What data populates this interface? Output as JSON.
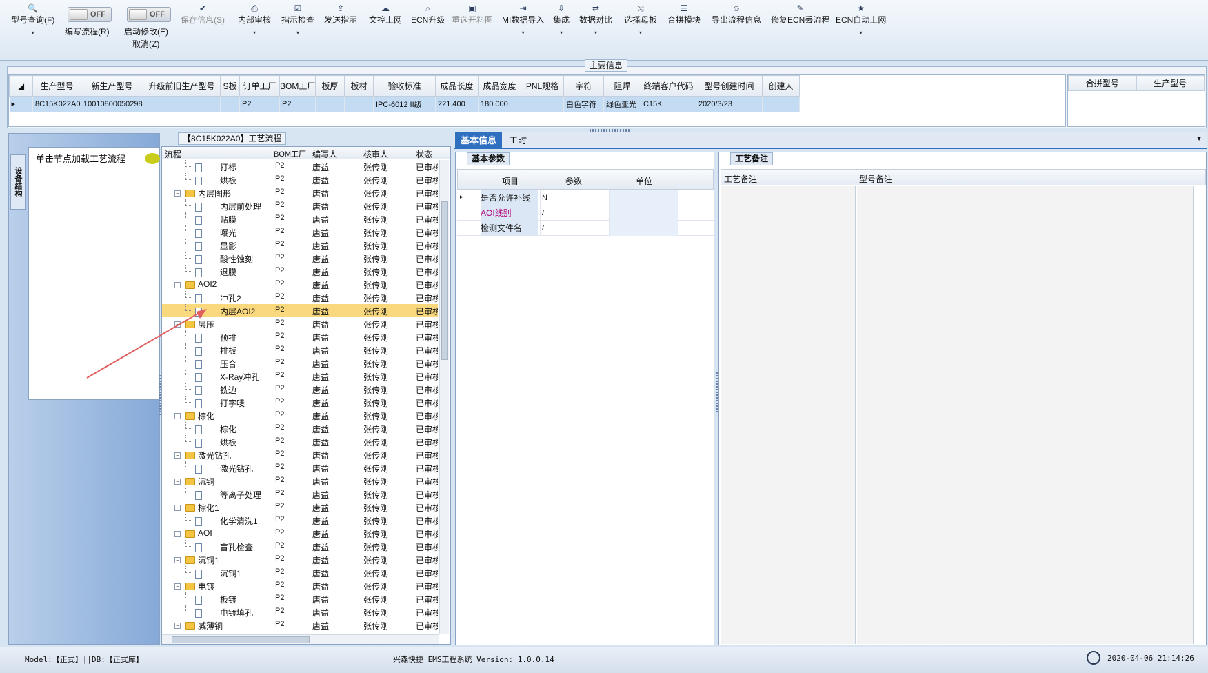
{
  "toolbar": {
    "items": [
      {
        "label": "型号查询(F)",
        "icon": "search-icon",
        "dropdown": true,
        "disabled": false
      },
      {
        "label": "保存信息(S)",
        "icon": "check-icon",
        "dropdown": false,
        "disabled": true
      },
      {
        "label": "内部审核",
        "icon": "printer-icon",
        "dropdown": true,
        "disabled": false
      },
      {
        "label": "指示检查",
        "icon": "checkbox-icon",
        "dropdown": true,
        "disabled": false
      },
      {
        "label": "发送指示",
        "icon": "upload-icon",
        "dropdown": false,
        "disabled": false
      },
      {
        "label": "文控上网",
        "icon": "cloud-icon",
        "dropdown": false,
        "disabled": false
      },
      {
        "label": "ECN升级",
        "icon": "binoculars-icon",
        "dropdown": false,
        "disabled": false
      },
      {
        "label": "重选开料图",
        "icon": "image-icon",
        "dropdown": false,
        "disabled": true
      },
      {
        "label": "MI数据导入",
        "icon": "import-icon",
        "dropdown": true,
        "disabled": false
      },
      {
        "label": "集成",
        "icon": "download-icon",
        "dropdown": true,
        "disabled": false
      },
      {
        "label": "数据对比",
        "icon": "compare-icon",
        "dropdown": true,
        "disabled": false
      },
      {
        "label": "选择母板",
        "icon": "shuffle-icon",
        "dropdown": true,
        "disabled": false
      },
      {
        "label": "合拼模块",
        "icon": "list-icon",
        "dropdown": false,
        "disabled": false
      },
      {
        "label": "导出流程信息",
        "icon": "smile-icon",
        "dropdown": false,
        "disabled": false
      },
      {
        "label": "修复ECN丢流程",
        "icon": "wrench-icon",
        "dropdown": false,
        "disabled": false
      },
      {
        "label": "ECN自动上网",
        "icon": "star-icon",
        "dropdown": true,
        "disabled": false
      }
    ],
    "toggles": [
      {
        "label": "编写流程(R)",
        "state": "OFF"
      },
      {
        "label": "启动修改(E)",
        "state": "OFF",
        "sub_label": "取消(Z)"
      }
    ]
  },
  "main_info": {
    "title": "主要信息",
    "columns": [
      "生产型号",
      "新生产型号",
      "升级前旧生产型号",
      "S板",
      "订单工厂",
      "BOM工厂",
      "板厚",
      "板材",
      "验收标准",
      "成品长度",
      "成品宽度",
      "PNL规格",
      "字符",
      "阻焊",
      "终端客户代码",
      "型号创建时间",
      "创建人"
    ],
    "rows": [
      [
        "8C15K022A0",
        "10010800050298",
        "",
        "",
        "P2",
        "P2",
        "",
        "",
        "IPC-6012 II级",
        "221.400",
        "180.000",
        "",
        "白色字符",
        "绿色亚光",
        "C15K",
        "2020/3/23",
        ""
      ]
    ],
    "side_columns": [
      "合拼型号",
      "生产型号"
    ]
  },
  "left_panel": {
    "vertical_tab": "设备结构",
    "item": "单击节点加载工艺流程"
  },
  "flow": {
    "title": "【8C15K022A0】工艺流程",
    "columns": [
      "流程",
      "BOM工厂",
      "编写人",
      "核审人",
      "状态"
    ],
    "rows": [
      {
        "name": "打标",
        "type": "file",
        "bom": "P2",
        "writer": "唐益",
        "reviewer": "张传刚",
        "status": "已审核"
      },
      {
        "name": "烘板",
        "type": "file",
        "bom": "P2",
        "writer": "唐益",
        "reviewer": "张传刚",
        "status": "已审核"
      },
      {
        "name": "内层图形",
        "type": "folder",
        "bom": "P2",
        "writer": "唐益",
        "reviewer": "张传刚",
        "status": "已审核"
      },
      {
        "name": "内层前处理",
        "type": "file",
        "bom": "P2",
        "writer": "唐益",
        "reviewer": "张传刚",
        "status": "已审核"
      },
      {
        "name": "贴膜",
        "type": "file",
        "bom": "P2",
        "writer": "唐益",
        "reviewer": "张传刚",
        "status": "已审核"
      },
      {
        "name": "曝光",
        "type": "file",
        "bom": "P2",
        "writer": "唐益",
        "reviewer": "张传刚",
        "status": "已审核"
      },
      {
        "name": "显影",
        "type": "file",
        "bom": "P2",
        "writer": "唐益",
        "reviewer": "张传刚",
        "status": "已审核"
      },
      {
        "name": "酸性蚀刻",
        "type": "file",
        "bom": "P2",
        "writer": "唐益",
        "reviewer": "张传刚",
        "status": "已审核"
      },
      {
        "name": "退膜",
        "type": "file",
        "bom": "P2",
        "writer": "唐益",
        "reviewer": "张传刚",
        "status": "已审核"
      },
      {
        "name": "AOI2",
        "type": "folder",
        "bom": "P2",
        "writer": "唐益",
        "reviewer": "张传刚",
        "status": "已审核"
      },
      {
        "name": "冲孔2",
        "type": "file",
        "bom": "P2",
        "writer": "唐益",
        "reviewer": "张传刚",
        "status": "已审核"
      },
      {
        "name": "内层AOI2",
        "type": "file",
        "bom": "P2",
        "writer": "唐益",
        "reviewer": "张传刚",
        "status": "已审核",
        "selected": true
      },
      {
        "name": "层压",
        "type": "folder",
        "bom": "P2",
        "writer": "唐益",
        "reviewer": "张传刚",
        "status": "已审核"
      },
      {
        "name": "预排",
        "type": "file",
        "bom": "P2",
        "writer": "唐益",
        "reviewer": "张传刚",
        "status": "已审核"
      },
      {
        "name": "排板",
        "type": "file",
        "bom": "P2",
        "writer": "唐益",
        "reviewer": "张传刚",
        "status": "已审核"
      },
      {
        "name": "压合",
        "type": "file",
        "bom": "P2",
        "writer": "唐益",
        "reviewer": "张传刚",
        "status": "已审核"
      },
      {
        "name": "X-Ray冲孔",
        "type": "file",
        "bom": "P2",
        "writer": "唐益",
        "reviewer": "张传刚",
        "status": "已审核"
      },
      {
        "name": "铣边",
        "type": "file",
        "bom": "P2",
        "writer": "唐益",
        "reviewer": "张传刚",
        "status": "已审核"
      },
      {
        "name": "打字唛",
        "type": "file",
        "bom": "P2",
        "writer": "唐益",
        "reviewer": "张传刚",
        "status": "已审核"
      },
      {
        "name": "棕化",
        "type": "folder",
        "bom": "P2",
        "writer": "唐益",
        "reviewer": "张传刚",
        "status": "已审核"
      },
      {
        "name": "棕化",
        "type": "file",
        "bom": "P2",
        "writer": "唐益",
        "reviewer": "张传刚",
        "status": "已审核"
      },
      {
        "name": "烘板",
        "type": "file",
        "bom": "P2",
        "writer": "唐益",
        "reviewer": "张传刚",
        "status": "已审核"
      },
      {
        "name": "激光钻孔",
        "type": "folder",
        "bom": "P2",
        "writer": "唐益",
        "reviewer": "张传刚",
        "status": "已审核"
      },
      {
        "name": "激光钻孔",
        "type": "file",
        "bom": "P2",
        "writer": "唐益",
        "reviewer": "张传刚",
        "status": "已审核"
      },
      {
        "name": "沉铜",
        "type": "folder",
        "bom": "P2",
        "writer": "唐益",
        "reviewer": "张传刚",
        "status": "已审核"
      },
      {
        "name": "等离子处理",
        "type": "file",
        "bom": "P2",
        "writer": "唐益",
        "reviewer": "张传刚",
        "status": "已审核"
      },
      {
        "name": "棕化1",
        "type": "folder",
        "bom": "P2",
        "writer": "唐益",
        "reviewer": "张传刚",
        "status": "已审核"
      },
      {
        "name": "化学清洗1",
        "type": "file",
        "bom": "P2",
        "writer": "唐益",
        "reviewer": "张传刚",
        "status": "已审核"
      },
      {
        "name": "AOI",
        "type": "folder",
        "bom": "P2",
        "writer": "唐益",
        "reviewer": "张传刚",
        "status": "已审核"
      },
      {
        "name": "盲孔检查",
        "type": "file",
        "bom": "P2",
        "writer": "唐益",
        "reviewer": "张传刚",
        "status": "已审核"
      },
      {
        "name": "沉铜1",
        "type": "folder",
        "bom": "P2",
        "writer": "唐益",
        "reviewer": "张传刚",
        "status": "已审核"
      },
      {
        "name": "沉铜1",
        "type": "file",
        "bom": "P2",
        "writer": "唐益",
        "reviewer": "张传刚",
        "status": "已审核"
      },
      {
        "name": "电镀",
        "type": "folder",
        "bom": "P2",
        "writer": "唐益",
        "reviewer": "张传刚",
        "status": "已审核"
      },
      {
        "name": "板镀",
        "type": "file",
        "bom": "P2",
        "writer": "唐益",
        "reviewer": "张传刚",
        "status": "已审核"
      },
      {
        "name": "电镀填孔",
        "type": "file",
        "bom": "P2",
        "writer": "唐益",
        "reviewer": "张传刚",
        "status": "已审核"
      },
      {
        "name": "减薄铜",
        "type": "folder",
        "bom": "P2",
        "writer": "唐益",
        "reviewer": "张传刚",
        "status": "已审核"
      }
    ]
  },
  "right": {
    "tabs": [
      "基本信息",
      "工时"
    ],
    "basic_params": {
      "title": "基本参数",
      "columns": [
        "项目",
        "参数",
        "单位"
      ],
      "rows": [
        {
          "item": "是否允许补线",
          "value": "N",
          "unit": "",
          "item_color": "#1a1a1a"
        },
        {
          "item": "AOI线别",
          "value": "/",
          "unit": "",
          "item_color": "#b0007a"
        },
        {
          "item": "检测文件名",
          "value": "/",
          "unit": "",
          "item_color": "#1a1a1a"
        }
      ]
    },
    "notes": {
      "title": "工艺备注",
      "columns": [
        "工艺备注",
        "型号备注"
      ]
    }
  },
  "statusbar": {
    "left": "Model:【正式】||DB:【正式库】",
    "center": "兴森快捷 EMS工程系统 Version: 1.0.0.14",
    "right": "2020-04-06 21:14:26"
  },
  "colors": {
    "accent": "#2f6fc0",
    "selection": "#f9d87e",
    "arrow": "#e06060"
  }
}
